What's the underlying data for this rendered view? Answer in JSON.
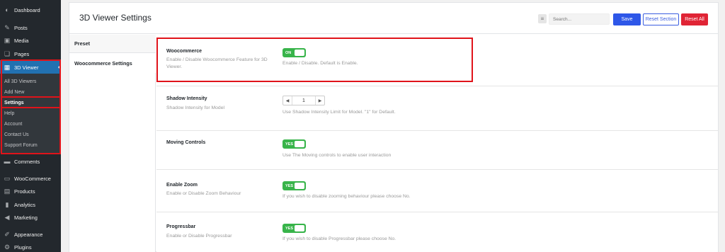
{
  "sidebar": {
    "items": [
      {
        "label": "Dashboard",
        "icon": "dashboard-icon",
        "glyph": "◐"
      },
      {
        "label": "Posts",
        "icon": "pin-icon",
        "glyph": "✎"
      },
      {
        "label": "Media",
        "icon": "media-icon",
        "glyph": "▣"
      },
      {
        "label": "Pages",
        "icon": "pages-icon",
        "glyph": "❏"
      },
      {
        "label": "3D Viewer",
        "icon": "3d-viewer-icon",
        "glyph": "▦"
      },
      {
        "label": "Comments",
        "icon": "comments-icon",
        "glyph": "▬"
      },
      {
        "label": "WooCommerce",
        "icon": "woocommerce-icon",
        "glyph": "▭"
      },
      {
        "label": "Products",
        "icon": "products-icon",
        "glyph": "▤"
      },
      {
        "label": "Analytics",
        "icon": "analytics-icon",
        "glyph": "▮"
      },
      {
        "label": "Marketing",
        "icon": "marketing-icon",
        "glyph": "◀"
      },
      {
        "label": "Appearance",
        "icon": "appearance-icon",
        "glyph": "✐"
      },
      {
        "label": "Plugins",
        "icon": "plugins-icon",
        "glyph": "⚙"
      }
    ],
    "submenu": [
      "All 3D Viewers",
      "Add New",
      "Settings",
      "Help",
      "Account",
      "Contact Us",
      "Support Forum"
    ]
  },
  "header": {
    "title": "3D Viewer Settings",
    "search_placeholder": "Search...",
    "save_label": "Save",
    "reset_section_label": "Reset Section",
    "reset_all_label": "Reset All"
  },
  "tabs": [
    "Preset",
    "Woocommerce Settings"
  ],
  "settings": {
    "woocommerce": {
      "label": "Woocommerce",
      "desc": "Enable / Disable Woocommerce Feature for 3D Viewer.",
      "toggle": "ON",
      "help": "Enable / Disable. Default is Enable."
    },
    "shadow": {
      "label": "Shadow Intensity",
      "desc": "Shadow Intensity for Model",
      "value": "1",
      "help": "Use Shadow Intensity Limit for Model. \"1\" for Default."
    },
    "moving": {
      "label": "Moving Controls",
      "desc": "",
      "toggle": "YES",
      "help": "Use The Moving controls to enable user interaction"
    },
    "zoom": {
      "label": "Enable Zoom",
      "desc": "Enable or Disable Zoom Behaviour",
      "toggle": "YES",
      "help": "If you wish to disable zooming behaviour please choose No."
    },
    "progressbar": {
      "label": "Progressbar",
      "desc": "Enable or Disable Progressbar",
      "toggle": "YES",
      "help": "If you wish to disable Progressbar please choose No."
    }
  },
  "colors": {
    "highlight": "#e0131a",
    "toggle_on": "#38b44a",
    "save": "#2e57e8",
    "reset_all": "#e02435"
  }
}
